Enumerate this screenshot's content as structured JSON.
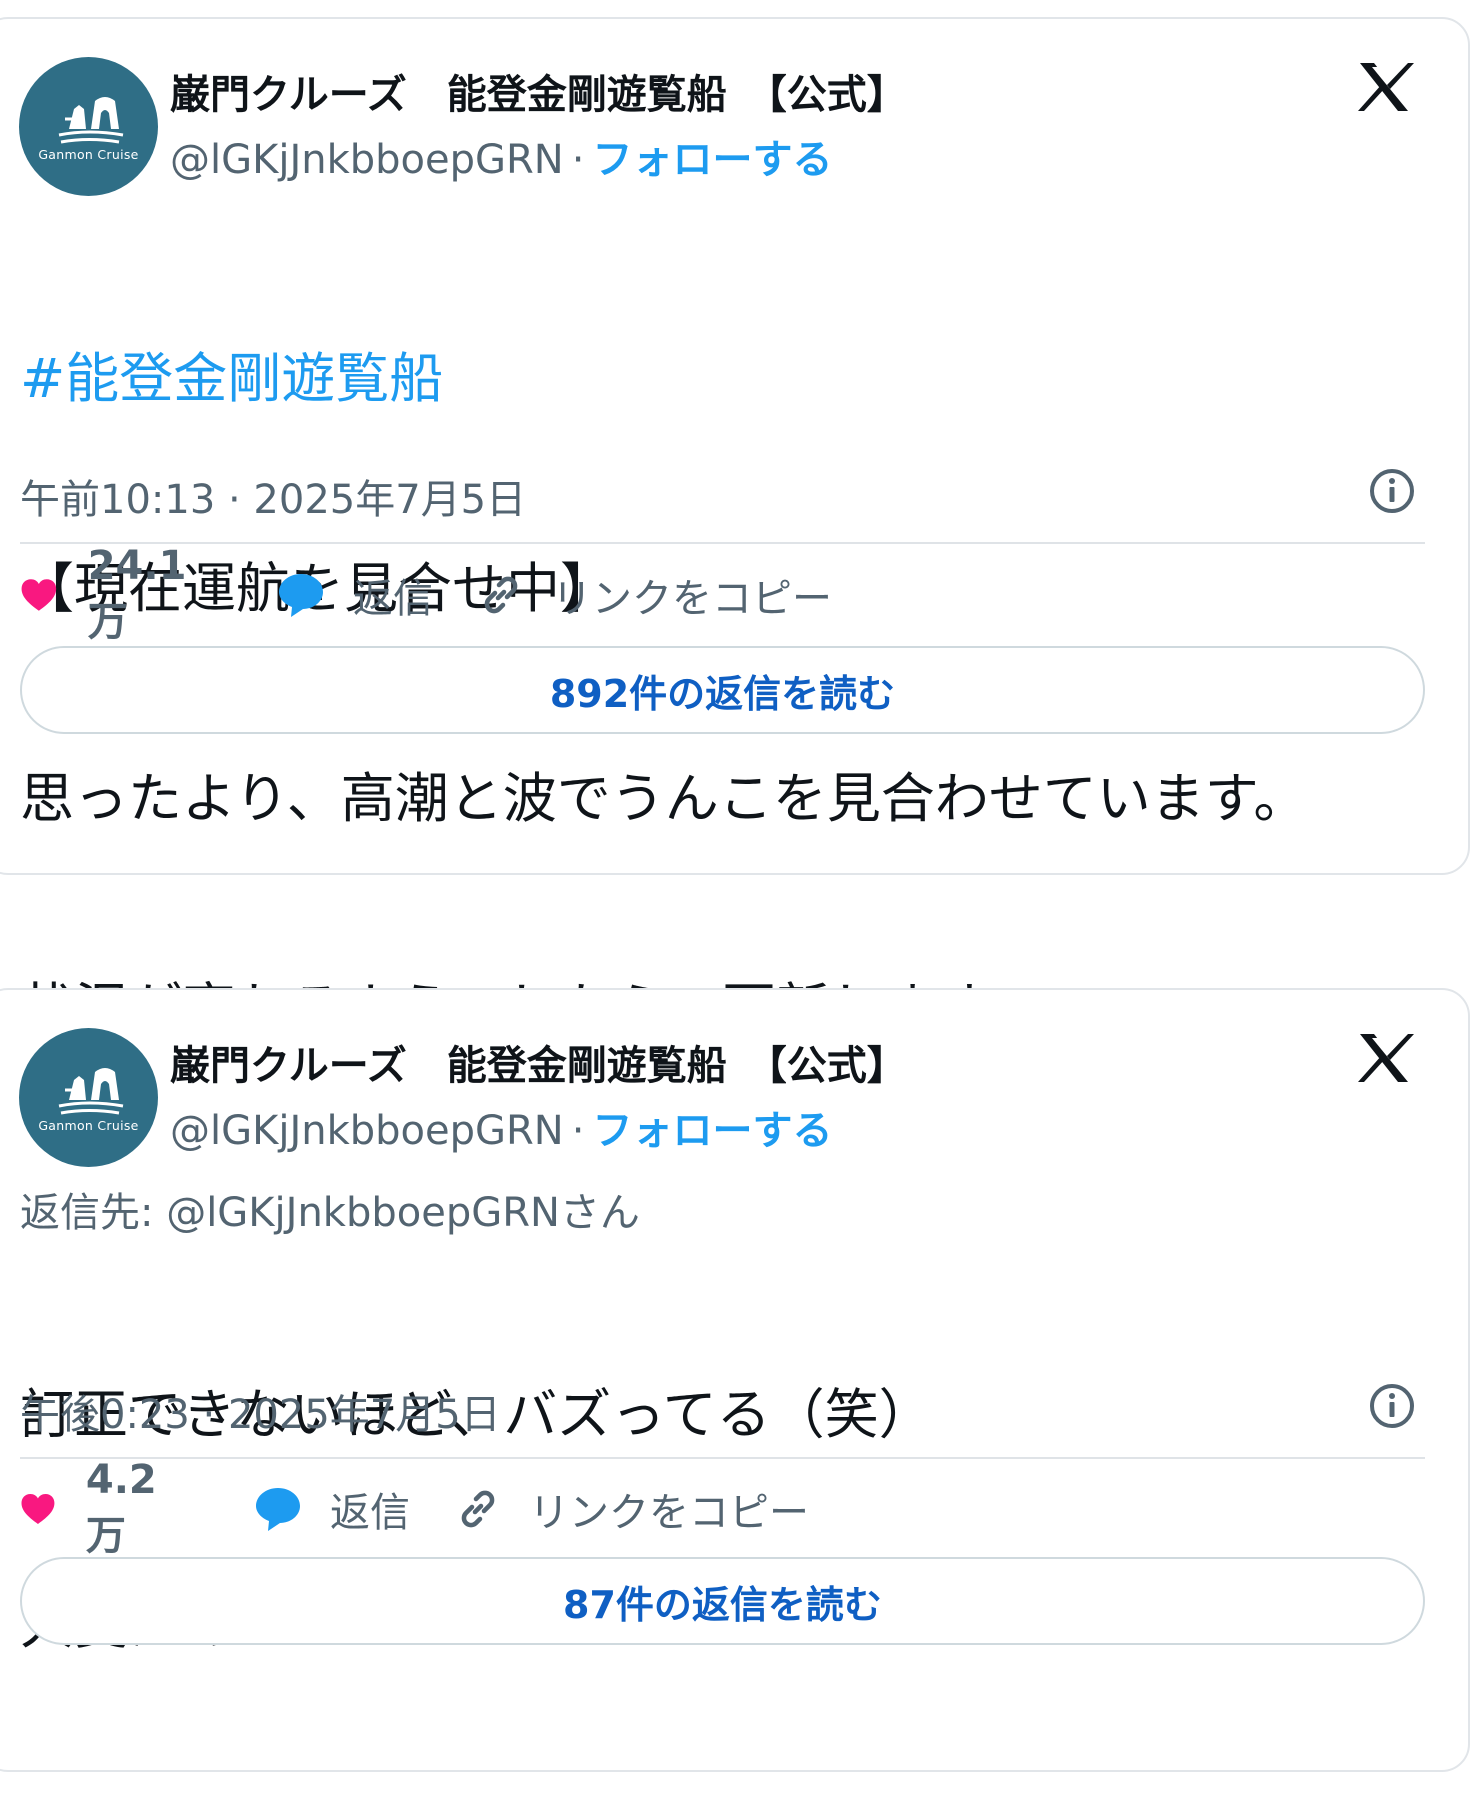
{
  "posts": [
    {
      "author": {
        "name": "巌門クルーズ　能登金剛遊覧船　【公式】",
        "handle": "@lGKjJnkbboepGRN",
        "separator": "·",
        "follow_label": "フォローする",
        "avatar_text": "Ganmon Cruise"
      },
      "hashtag": "#能登金剛遊覧船",
      "text_lines": [
        "【現在運航を見合せ中】",
        "思ったより、高潮と波でうんこを見合わせています。",
        "状況が変わるようでしたら、更新します。"
      ],
      "timestamp": "午前10:13 · 2025年7月5日",
      "likes": "24.1万",
      "reply_label": "返信",
      "copy_link_label": "リンクをコピー",
      "read_replies_label": "892件の返信を読む"
    },
    {
      "author": {
        "name": "巌門クルーズ　能登金剛遊覧船　【公式】",
        "handle": "@lGKjJnkbboepGRN",
        "separator": "·",
        "follow_label": "フォローする",
        "avatar_text": "Ganmon Cruise"
      },
      "reply_to": "返信先: @lGKjJnkbboepGRNさん",
      "text_lines": [
        "訂正できないほど、バズってる（笑）",
        "大変だぁ"
      ],
      "timestamp": "午後0:23 · 2025年7月5日",
      "likes": "4.2万",
      "reply_label": "返信",
      "copy_link_label": "リンクをコピー",
      "read_replies_label": "87件の返信を読む"
    }
  ],
  "colors": {
    "accent": "#1d9bf0",
    "like": "#f91880",
    "avatar_bg": "#2f6e86",
    "muted": "#536471"
  },
  "icons": [
    "x-logo-icon",
    "info-icon",
    "heart-icon",
    "speech-bubble-icon",
    "link-icon"
  ]
}
